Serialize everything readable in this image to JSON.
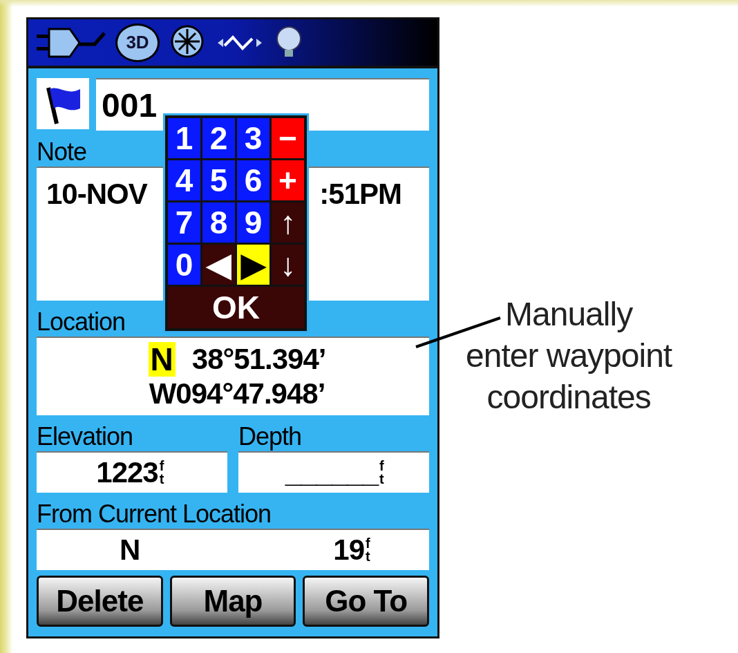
{
  "status_bar": {
    "fix_mode": "3D"
  },
  "waypoint": {
    "name": "001"
  },
  "note": {
    "label": "Note",
    "visible_parts": [
      "10-NOV",
      ":51PM"
    ]
  },
  "location": {
    "label": "Location",
    "lat_hemisphere": "N",
    "lat_hemisphere_selected": true,
    "lat_value": "38°51.394’",
    "lon": "W094°47.948’"
  },
  "elevation": {
    "label": "Elevation",
    "value": "1223",
    "unit": "ft"
  },
  "depth": {
    "label": "Depth",
    "value": "______",
    "unit": "ft"
  },
  "from_current": {
    "label": "From Current Location",
    "bearing": "N",
    "distance": "19",
    "unit": "ft"
  },
  "buttons": [
    "Delete",
    "Map",
    "Go To"
  ],
  "keypad": {
    "keys": [
      {
        "label": "1",
        "kind": "digit",
        "selected": false
      },
      {
        "label": "2",
        "kind": "digit",
        "selected": false
      },
      {
        "label": "3",
        "kind": "digit",
        "selected": false
      },
      {
        "label": "−",
        "kind": "sign",
        "selected": false
      },
      {
        "label": "4",
        "kind": "digit",
        "selected": false
      },
      {
        "label": "5",
        "kind": "digit",
        "selected": false
      },
      {
        "label": "6",
        "kind": "digit",
        "selected": false
      },
      {
        "label": "+",
        "kind": "sign",
        "selected": false
      },
      {
        "label": "7",
        "kind": "digit",
        "selected": false
      },
      {
        "label": "8",
        "kind": "digit",
        "selected": false
      },
      {
        "label": "9",
        "kind": "digit",
        "selected": false
      },
      {
        "label": "↑",
        "kind": "nav",
        "selected": false
      },
      {
        "label": "0",
        "kind": "digit",
        "selected": false
      },
      {
        "label": "◀",
        "kind": "nav",
        "selected": false
      },
      {
        "label": "▶",
        "kind": "nav",
        "selected": true
      },
      {
        "label": "↓",
        "kind": "nav",
        "selected": false
      }
    ],
    "ok": "OK"
  },
  "annotation": {
    "lines": [
      "Manually",
      "enter waypoint",
      "coordinates"
    ]
  }
}
